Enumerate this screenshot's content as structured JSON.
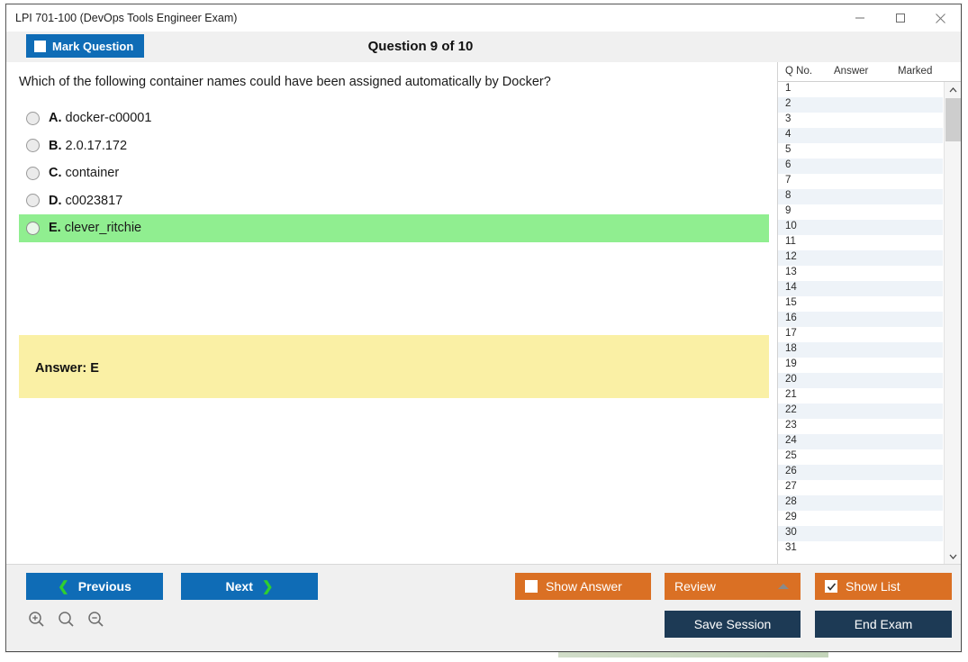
{
  "window": {
    "title": "LPI 701-100 (DevOps Tools Engineer Exam)",
    "controls": {
      "minimize": "minimize-icon",
      "maximize": "maximize-icon",
      "close": "close-icon"
    }
  },
  "header": {
    "mark_question_label": "Mark Question",
    "mark_question_checked": false,
    "question_counter": "Question 9 of 10"
  },
  "question": {
    "text": "Which of the following container names could have been assigned automatically by Docker?",
    "options": [
      {
        "letter": "A.",
        "text": "docker-c00001",
        "selected": false,
        "correct": false
      },
      {
        "letter": "B.",
        "text": "2.0.17.172",
        "selected": false,
        "correct": false
      },
      {
        "letter": "C.",
        "text": "container",
        "selected": false,
        "correct": false
      },
      {
        "letter": "D.",
        "text": "c0023817",
        "selected": false,
        "correct": false
      },
      {
        "letter": "E.",
        "text": "clever_ritchie",
        "selected": false,
        "correct": true
      }
    ],
    "answer_label": "Answer: E"
  },
  "list": {
    "columns": [
      "Q No.",
      "Answer",
      "Marked"
    ],
    "rows": [
      {
        "no": "1",
        "answer": "",
        "marked": ""
      },
      {
        "no": "2",
        "answer": "",
        "marked": ""
      },
      {
        "no": "3",
        "answer": "",
        "marked": ""
      },
      {
        "no": "4",
        "answer": "",
        "marked": ""
      },
      {
        "no": "5",
        "answer": "",
        "marked": ""
      },
      {
        "no": "6",
        "answer": "",
        "marked": ""
      },
      {
        "no": "7",
        "answer": "",
        "marked": ""
      },
      {
        "no": "8",
        "answer": "",
        "marked": ""
      },
      {
        "no": "9",
        "answer": "",
        "marked": ""
      },
      {
        "no": "10",
        "answer": "",
        "marked": ""
      },
      {
        "no": "11",
        "answer": "",
        "marked": ""
      },
      {
        "no": "12",
        "answer": "",
        "marked": ""
      },
      {
        "no": "13",
        "answer": "",
        "marked": ""
      },
      {
        "no": "14",
        "answer": "",
        "marked": ""
      },
      {
        "no": "15",
        "answer": "",
        "marked": ""
      },
      {
        "no": "16",
        "answer": "",
        "marked": ""
      },
      {
        "no": "17",
        "answer": "",
        "marked": ""
      },
      {
        "no": "18",
        "answer": "",
        "marked": ""
      },
      {
        "no": "19",
        "answer": "",
        "marked": ""
      },
      {
        "no": "20",
        "answer": "",
        "marked": ""
      },
      {
        "no": "21",
        "answer": "",
        "marked": ""
      },
      {
        "no": "22",
        "answer": "",
        "marked": ""
      },
      {
        "no": "23",
        "answer": "",
        "marked": ""
      },
      {
        "no": "24",
        "answer": "",
        "marked": ""
      },
      {
        "no": "25",
        "answer": "",
        "marked": ""
      },
      {
        "no": "26",
        "answer": "",
        "marked": ""
      },
      {
        "no": "27",
        "answer": "",
        "marked": ""
      },
      {
        "no": "28",
        "answer": "",
        "marked": ""
      },
      {
        "no": "29",
        "answer": "",
        "marked": ""
      },
      {
        "no": "30",
        "answer": "",
        "marked": ""
      },
      {
        "no": "31",
        "answer": "",
        "marked": ""
      }
    ]
  },
  "footer": {
    "previous_label": "Previous",
    "next_label": "Next",
    "prev_chevron": "chevron-left-icon",
    "next_chevron": "chevron-right-icon",
    "show_answer_label": "Show Answer",
    "show_answer_checked": false,
    "review_label": "Review",
    "review_caret": "chevron-up-icon",
    "show_list_label": "Show List",
    "show_list_checked": true,
    "show_list_check_glyph": "✓",
    "save_session_label": "Save Session",
    "end_exam_label": "End Exam",
    "zoom_in": "zoom-in-icon",
    "zoom_reset": "zoom-icon",
    "zoom_out": "zoom-out-icon"
  },
  "colors": {
    "accent_blue": "#0f6cb6",
    "accent_orange": "#da7024",
    "dark_navy": "#1d3a55",
    "correct_green": "#90ee90",
    "answer_yellow": "#faf0a5",
    "chevron_green": "#2fcf2f",
    "header_gray": "#f0f0f0",
    "row_alt": "#eef3f8"
  }
}
